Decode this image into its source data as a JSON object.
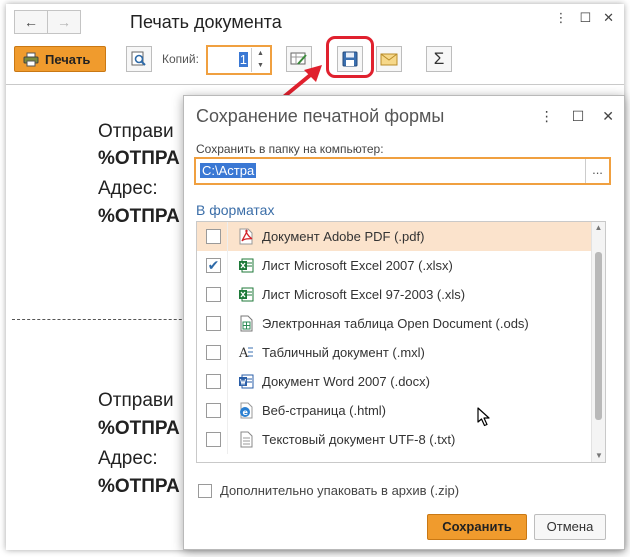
{
  "window": {
    "title": "Печать документа",
    "back_label": "←",
    "forward_label": "→",
    "more_label": "⋮",
    "maximize_label": "☐",
    "close_label": "✕"
  },
  "toolbar": {
    "print_label": "Печать",
    "copies_label": "Копий:",
    "copies_value": "1",
    "spin_up": "▲",
    "spin_down": "▼",
    "sum_label": "Σ"
  },
  "document": {
    "block1_line1": "Отправи",
    "block1_line2": "%ОТПРА",
    "block1_line3": "Адрес:",
    "block1_line4": "%ОТПРА",
    "block2_line1": "Отправи",
    "block2_line2": "%ОТПРА",
    "block2_line3": "Адрес:",
    "block2_line4": "%ОТПРА"
  },
  "dialog": {
    "title": "Сохранение печатной формы",
    "more_label": "⋮",
    "maximize_label": "☐",
    "close_label": "✕",
    "folder_label": "Сохранить в папку на компьютер:",
    "folder_value": "C:\\Астра",
    "browse_label": "...",
    "formats_title": "В форматах",
    "formats": [
      {
        "label": "Документ Adobe PDF (.pdf)",
        "icon": "pdf-icon",
        "checked": false,
        "check": ""
      },
      {
        "label": "Лист Microsoft Excel 2007 (.xlsx)",
        "icon": "excel-icon",
        "checked": true,
        "check": "✔"
      },
      {
        "label": "Лист Microsoft Excel 97-2003 (.xls)",
        "icon": "excel-icon",
        "checked": false,
        "check": ""
      },
      {
        "label": "Электронная таблица Open Document (.ods)",
        "icon": "ods-icon",
        "checked": false,
        "check": ""
      },
      {
        "label": "Табличный документ (.mxl)",
        "icon": "mxl-icon",
        "checked": false,
        "check": ""
      },
      {
        "label": "Документ Word 2007 (.docx)",
        "icon": "word-icon",
        "checked": false,
        "check": ""
      },
      {
        "label": "Веб-страница (.html)",
        "icon": "html-icon",
        "checked": false,
        "check": ""
      },
      {
        "label": "Текстовый документ UTF-8 (.txt)",
        "icon": "txt-icon",
        "checked": false,
        "check": ""
      }
    ],
    "scroll_up": "▲",
    "scroll_down": "▼",
    "zip_label": "Дополнительно упаковать в архив (.zip)",
    "save_label": "Сохранить",
    "cancel_label": "Отмена"
  },
  "colors": {
    "accent": "#f09b2d",
    "focus": "#f0a040",
    "highlight": "#e0212e",
    "link": "#3b6ea8"
  }
}
